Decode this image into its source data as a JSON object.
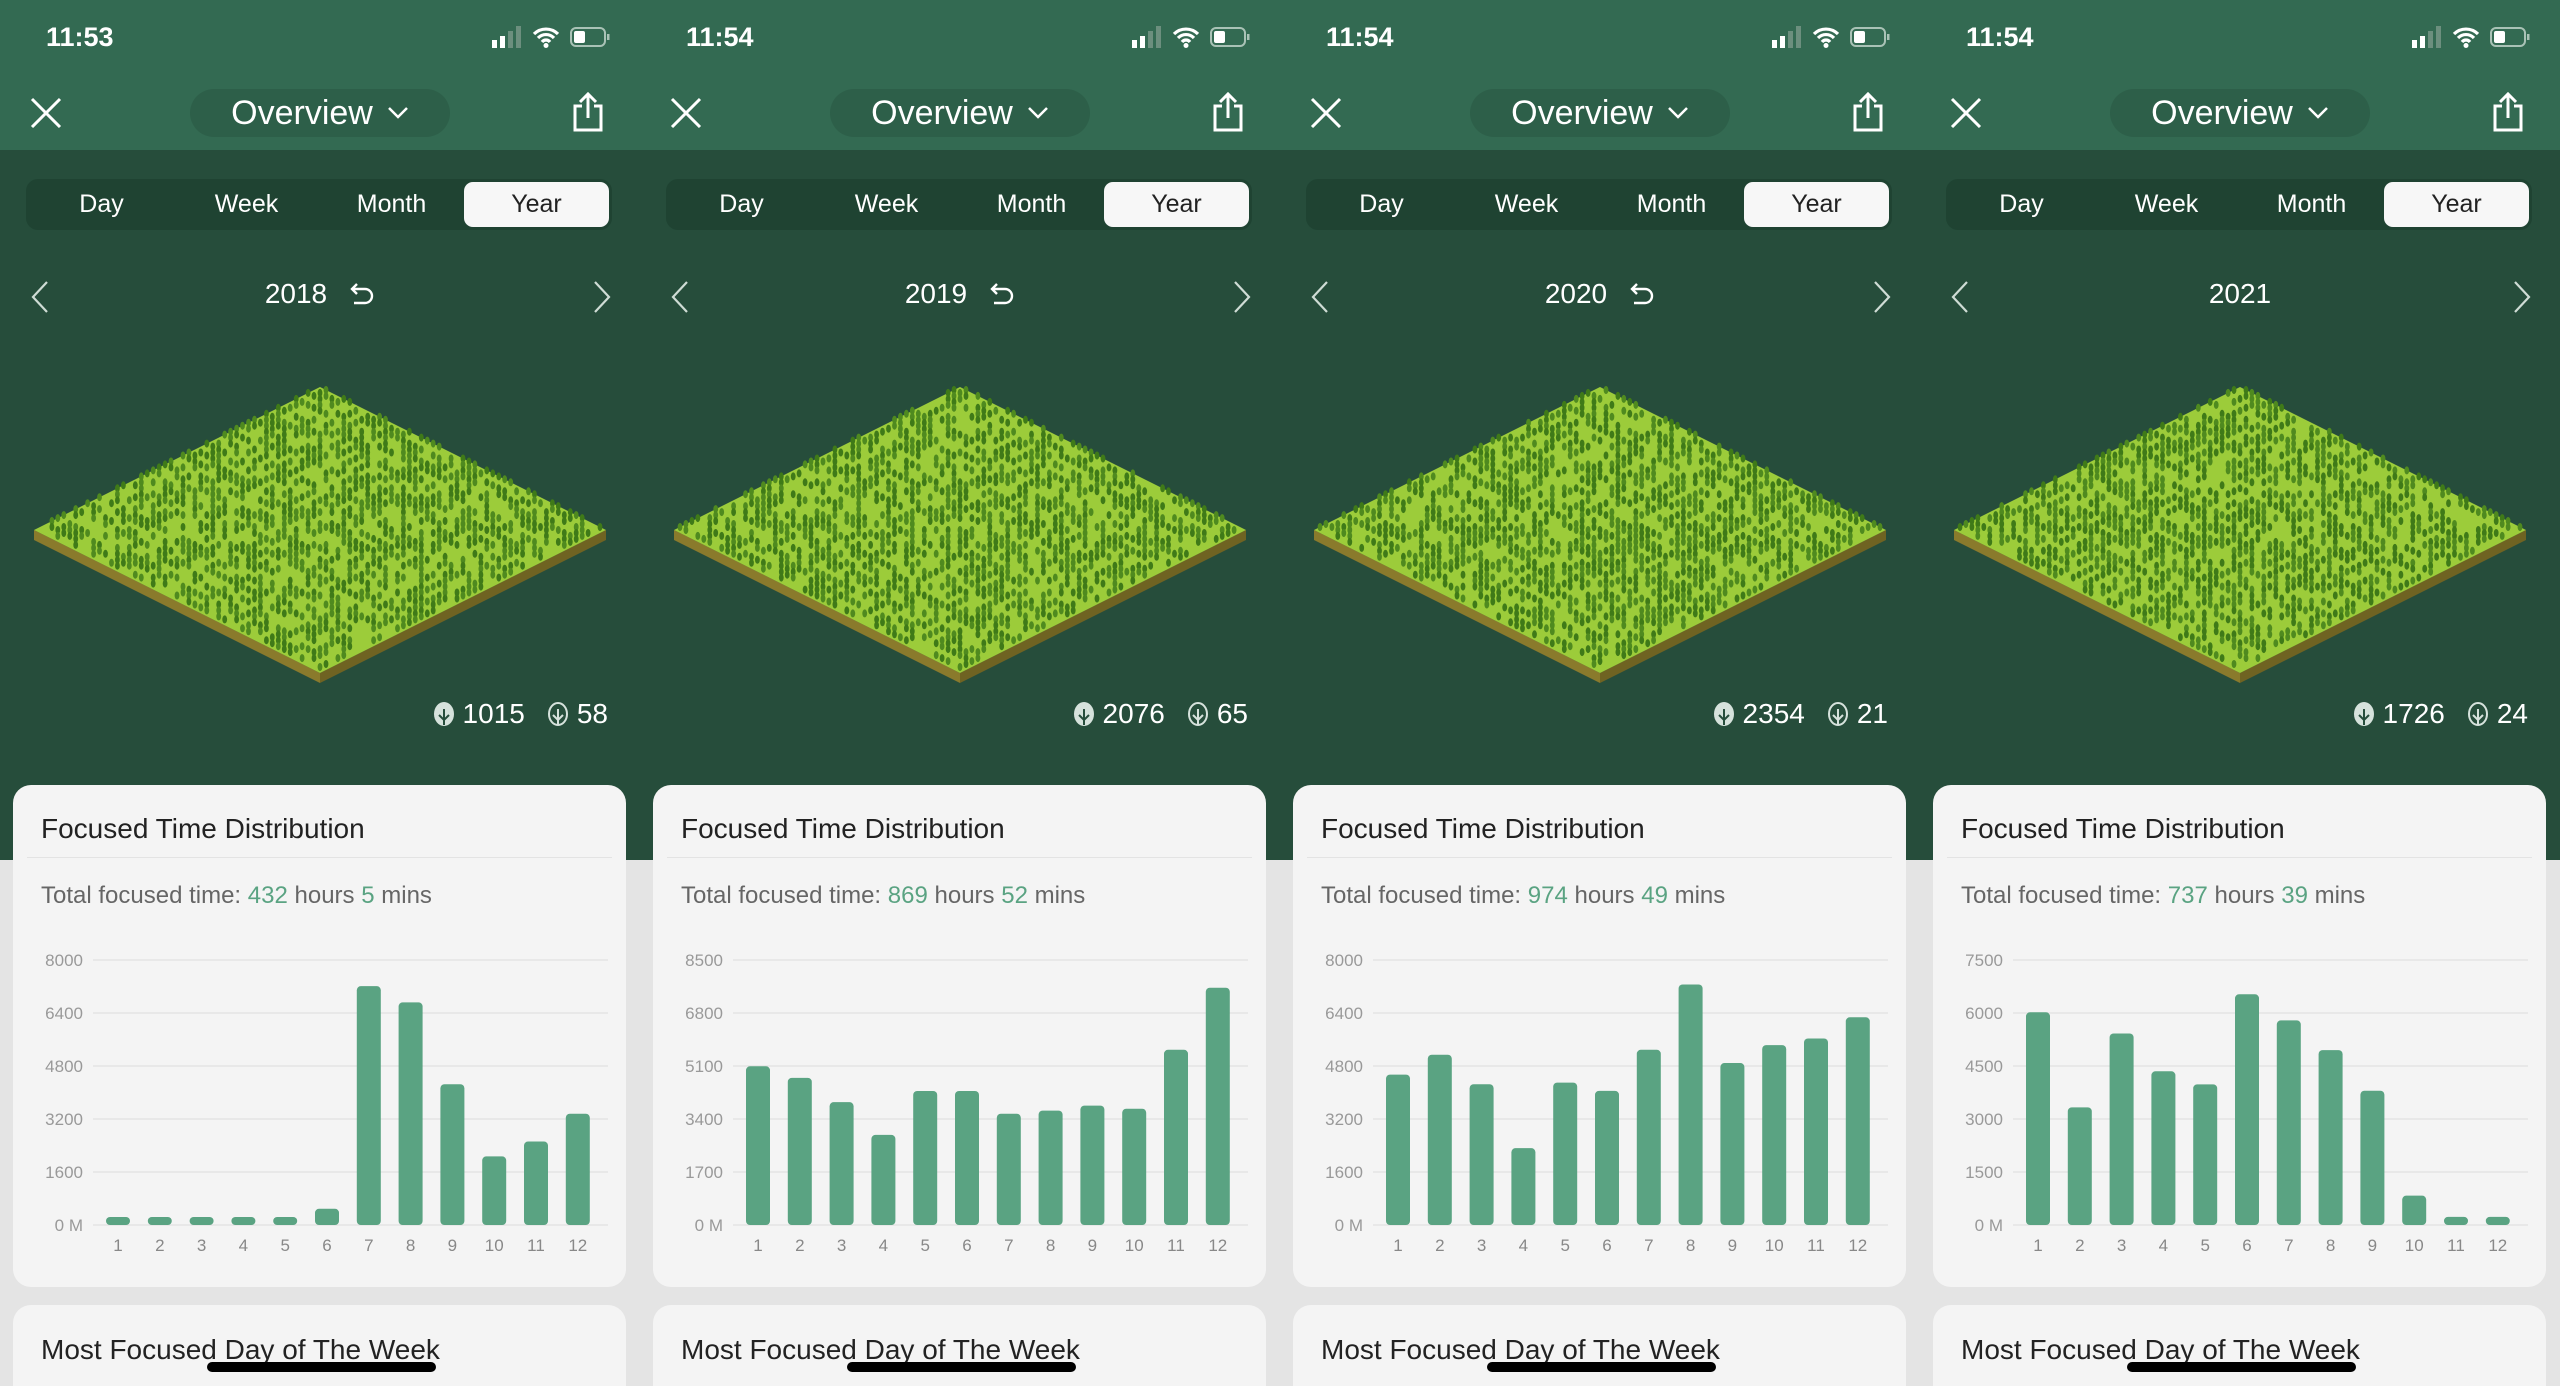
{
  "colors": {
    "accent": "#5aa382",
    "header": "#336a52",
    "background": "#264d3b",
    "forest": "#9ccc3a"
  },
  "common": {
    "dropdown_label": "Overview",
    "tabs": [
      "Day",
      "Week",
      "Month",
      "Year"
    ],
    "active_tab": "Year",
    "card_title": "Focused Time Distribution",
    "total_prefix": "Total focused time:",
    "hours_word": "hours",
    "mins_word": "mins",
    "next_card_title": "Most Focused Day of The Week",
    "icons": {
      "close": "close-icon",
      "dropdown": "chevron-down-icon",
      "share": "share-icon",
      "prev": "chevron-left-icon",
      "next": "chevron-right-icon",
      "reset": "undo-icon",
      "trees": "tree-icon",
      "dead": "dead-tree-icon"
    }
  },
  "panels": [
    {
      "time": "11:53",
      "year": "2018",
      "show_reset": true,
      "trees": "1015",
      "dead": "58",
      "hours": "432",
      "mins": "5",
      "chart_data": {
        "type": "bar",
        "categories": [
          "1",
          "2",
          "3",
          "4",
          "5",
          "6",
          "7",
          "8",
          "9",
          "10",
          "11",
          "12"
        ],
        "yticks": [
          "0 M",
          "1600",
          "3200",
          "4800",
          "6400",
          "8000"
        ],
        "ylim": [
          0,
          8000
        ],
        "values": [
          150,
          150,
          150,
          150,
          150,
          490,
          7210,
          6720,
          4250,
          2070,
          2520,
          3360
        ]
      }
    },
    {
      "time": "11:54",
      "year": "2019",
      "show_reset": true,
      "trees": "2076",
      "dead": "65",
      "hours": "869",
      "mins": "52",
      "chart_data": {
        "type": "bar",
        "categories": [
          "1",
          "2",
          "3",
          "4",
          "5",
          "6",
          "7",
          "8",
          "9",
          "10",
          "11",
          "12"
        ],
        "yticks": [
          "0 M",
          "1700",
          "3400",
          "5100",
          "6800",
          "8500"
        ],
        "ylim": [
          0,
          8500
        ],
        "values": [
          5090,
          4720,
          3940,
          2890,
          4300,
          4300,
          3570,
          3670,
          3830,
          3730,
          5620,
          7610
        ]
      }
    },
    {
      "time": "11:54",
      "year": "2020",
      "show_reset": true,
      "trees": "2354",
      "dead": "21",
      "hours": "974",
      "mins": "49",
      "chart_data": {
        "type": "bar",
        "categories": [
          "1",
          "2",
          "3",
          "4",
          "5",
          "6",
          "7",
          "8",
          "9",
          "10",
          "11",
          "12"
        ],
        "yticks": [
          "0 M",
          "1600",
          "3200",
          "4800",
          "6400",
          "8000"
        ],
        "ylim": [
          0,
          8000
        ],
        "values": [
          4540,
          5140,
          4250,
          2320,
          4300,
          4050,
          5290,
          7260,
          4890,
          5430,
          5630,
          6270
        ]
      }
    },
    {
      "time": "11:54",
      "year": "2021",
      "show_reset": false,
      "trees": "1726",
      "dead": "24",
      "hours": "737",
      "mins": "39",
      "chart_data": {
        "type": "bar",
        "categories": [
          "1",
          "2",
          "3",
          "4",
          "5",
          "6",
          "7",
          "8",
          "9",
          "10",
          "11",
          "12"
        ],
        "yticks": [
          "0 M",
          "1500",
          "3000",
          "4500",
          "6000",
          "7500"
        ],
        "ylim": [
          0,
          7500
        ],
        "values": [
          6020,
          3330,
          5420,
          4350,
          3980,
          6530,
          5790,
          4950,
          3800,
          830,
          230,
          230
        ]
      }
    }
  ]
}
